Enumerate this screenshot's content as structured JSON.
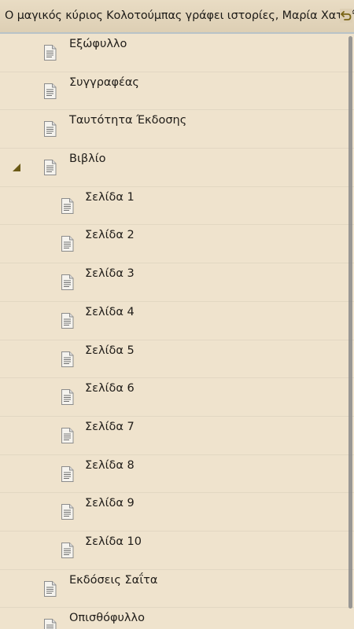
{
  "header": {
    "title": "Ο μαγικός κύριος Κολοτούμπας γράφει ιστορίες, Μαρία Χατζή",
    "back_icon": "return-arrow-icon"
  },
  "toc": {
    "items": [
      {
        "label": "Εξώφυλλο",
        "level": 0
      },
      {
        "label": "Συγγραφέας",
        "level": 0
      },
      {
        "label": "Ταυτότητα Έκδοσης",
        "level": 0
      },
      {
        "label": "Βιβλίο",
        "level": 0,
        "expanded": true
      },
      {
        "label": "Σελίδα 1",
        "level": 1
      },
      {
        "label": "Σελίδα 2",
        "level": 1
      },
      {
        "label": "Σελίδα 3",
        "level": 1
      },
      {
        "label": "Σελίδα 4",
        "level": 1
      },
      {
        "label": "Σελίδα 5",
        "level": 1
      },
      {
        "label": "Σελίδα 6",
        "level": 1
      },
      {
        "label": "Σελίδα 7",
        "level": 1
      },
      {
        "label": "Σελίδα 8",
        "level": 1
      },
      {
        "label": "Σελίδα 9",
        "level": 1
      },
      {
        "label": "Σελίδα 10",
        "level": 1
      },
      {
        "label": "Εκδόσεις Σαΐτα",
        "level": 0
      },
      {
        "label": "Οπισθόφυλλο",
        "level": 0
      }
    ],
    "item_icon": "document-icon",
    "expander_icon": "expand-triangle-icon"
  },
  "colors": {
    "background": "#efe3cd",
    "header": "#e1d4bb",
    "expander": "#6b5a16"
  }
}
